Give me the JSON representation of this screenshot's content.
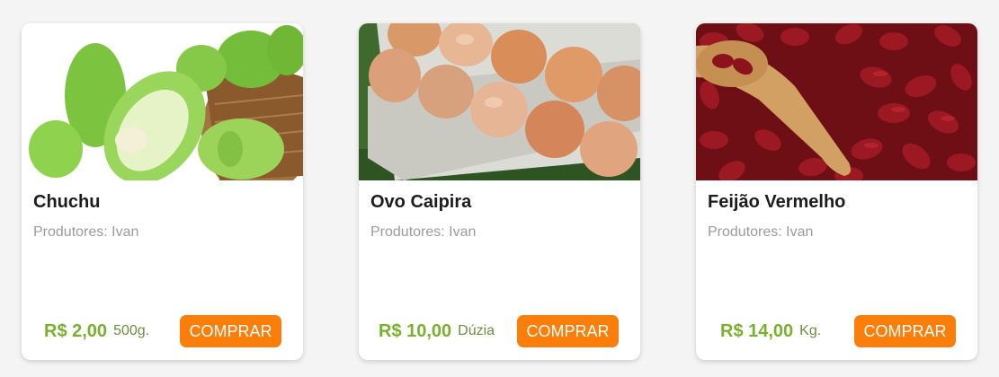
{
  "products": [
    {
      "name": "Chuchu",
      "producers": "Produtores: Ivan",
      "price": "R$ 2,00",
      "unit": "500g.",
      "buy_label": "COMPRAR",
      "image": "chayote-photo"
    },
    {
      "name": "Ovo Caipira",
      "producers": "Produtores: Ivan",
      "price": "R$ 10,00",
      "unit": "Dúzia",
      "buy_label": "COMPRAR",
      "image": "eggs-carton-photo"
    },
    {
      "name": "Feijão Vermelho",
      "producers": "Produtores: Ivan",
      "price": "R$ 14,00",
      "unit": "Kg.",
      "buy_label": "COMPRAR",
      "image": "red-beans-photo"
    }
  ],
  "colors": {
    "accent": "#fb7d0a",
    "price": "#79b12f",
    "background": "#f4f4f4"
  }
}
